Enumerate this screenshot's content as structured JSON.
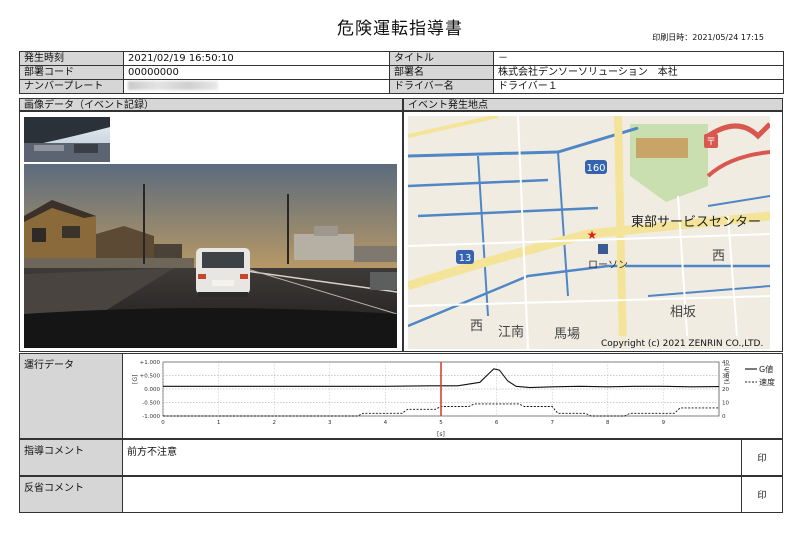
{
  "header": {
    "title": "危険運転指導書",
    "printed_label": "印刷日時：",
    "printed_value": "2021/05/24 17:15"
  },
  "info": {
    "occurred_label": "発生時刻",
    "occurred_value": "2021/02/19 16:50:10",
    "title_label": "タイトル",
    "title_value": "－",
    "dept_code_label": "部署コード",
    "dept_code_value": "00000000",
    "dept_name_label": "部署名",
    "dept_name_value": "株式会社デンソーソリューション　本社",
    "plate_label": "ナンバープレート",
    "driver_label": "ドライバー名",
    "driver_value": "ドライバー１"
  },
  "image_panel": {
    "label": "画像データ（イベント記録）"
  },
  "map_panel": {
    "label": "イベント発生地点",
    "copyright": "Copyright (c) 2021 ZENRIN CO.,LTD.",
    "places": {
      "center": "東部サービスセンター",
      "store": "ローソン",
      "west": "西",
      "west_south": "西",
      "konan": "江南",
      "baba": "馬場",
      "aisaka": "相坂",
      "route_160": "160",
      "route_13": "13"
    }
  },
  "operation": {
    "label": "運行データ",
    "legend_g": "G値",
    "legend_speed": "速度",
    "left_axis_unit": "[G]",
    "right_axis_unit": "[km/h]",
    "x_axis_unit": "[s]"
  },
  "chart_data": {
    "type": "line",
    "x": [
      0,
      1,
      2,
      3,
      4,
      5,
      6,
      7,
      8,
      9
    ],
    "xlim": [
      0,
      10
    ],
    "ylim": [
      -1.0,
      1.0
    ],
    "ylim_right": [
      0,
      40
    ],
    "left_ticks": [
      "+1.000",
      "+0.500",
      "0.000",
      "-0.500",
      "-1.000"
    ],
    "right_ticks": [
      "40",
      "30",
      "20",
      "10",
      "0"
    ],
    "event_time": 5,
    "series": [
      {
        "name": "G値",
        "axis": "left",
        "points": [
          [
            0,
            0.1
          ],
          [
            1,
            0.1
          ],
          [
            2,
            0.1
          ],
          [
            3,
            0.1
          ],
          [
            4,
            0.1
          ],
          [
            4.8,
            0.12
          ],
          [
            5.3,
            0.12
          ],
          [
            5.7,
            0.25
          ],
          [
            5.85,
            0.55
          ],
          [
            5.95,
            0.75
          ],
          [
            6.05,
            0.7
          ],
          [
            6.2,
            0.3
          ],
          [
            6.35,
            0.1
          ],
          [
            6.6,
            0.05
          ],
          [
            7,
            0.08
          ],
          [
            7.5,
            0.1
          ],
          [
            8,
            0.08
          ],
          [
            8.5,
            0.1
          ],
          [
            9,
            0.1
          ],
          [
            9.5,
            0.08
          ],
          [
            10,
            0.09
          ]
        ]
      },
      {
        "name": "速度",
        "axis": "right",
        "points": [
          [
            0,
            0
          ],
          [
            3.5,
            0
          ],
          [
            3.6,
            2
          ],
          [
            4.3,
            2
          ],
          [
            4.4,
            5
          ],
          [
            4.9,
            5
          ],
          [
            5.0,
            7
          ],
          [
            5.5,
            7
          ],
          [
            5.6,
            9
          ],
          [
            6.4,
            9
          ],
          [
            6.5,
            7
          ],
          [
            7.0,
            7
          ],
          [
            7.1,
            2
          ],
          [
            7.6,
            2
          ],
          [
            7.7,
            0
          ],
          [
            8.3,
            0
          ],
          [
            8.4,
            2
          ],
          [
            9.2,
            2
          ],
          [
            9.3,
            6
          ],
          [
            10,
            6
          ]
        ]
      }
    ]
  },
  "guidance": {
    "label": "指導コメント",
    "value": "前方不注意",
    "stamp": "印"
  },
  "reflection": {
    "label": "反省コメント",
    "value": "",
    "stamp": "印"
  }
}
